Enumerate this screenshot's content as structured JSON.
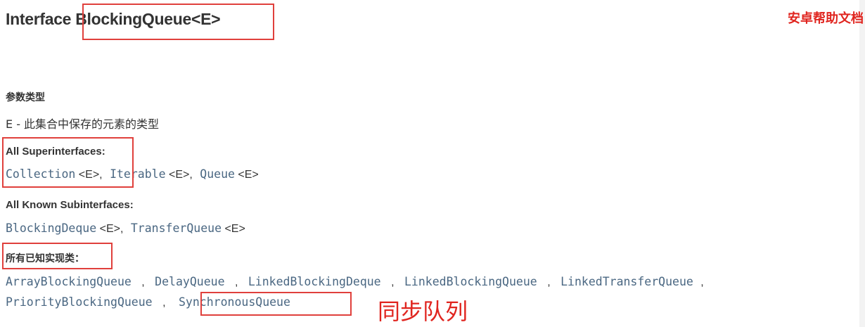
{
  "header": {
    "prefix": "Interface",
    "type_name": "BlockingQueue<E>",
    "brand": "安卓帮助文档"
  },
  "type_params": {
    "heading": "参数类型",
    "description": "E - 此集合中保存的元素的类型"
  },
  "superinterfaces": {
    "heading": "All Superinterfaces:",
    "items": [
      {
        "name": "Collection",
        "generic": "<E>"
      },
      {
        "name": "Iterable",
        "generic": "<E>"
      },
      {
        "name": "Queue",
        "generic": "<E>"
      }
    ],
    "separator": ","
  },
  "subinterfaces": {
    "heading": "All Known Subinterfaces:",
    "items": [
      {
        "name": "BlockingDeque",
        "generic": "<E>"
      },
      {
        "name": "TransferQueue",
        "generic": "<E>"
      }
    ],
    "separator": ","
  },
  "implementing_classes": {
    "heading": "所有已知实现类：",
    "items": [
      "ArrayBlockingQueue",
      "DelayQueue",
      "LinkedBlockingDeque",
      "LinkedBlockingQueue",
      "LinkedTransferQueue",
      "PriorityBlockingQueue",
      "SynchronousQueue"
    ],
    "separator": ","
  },
  "annotation": "同步队列",
  "highlight_color": "#e0403c"
}
